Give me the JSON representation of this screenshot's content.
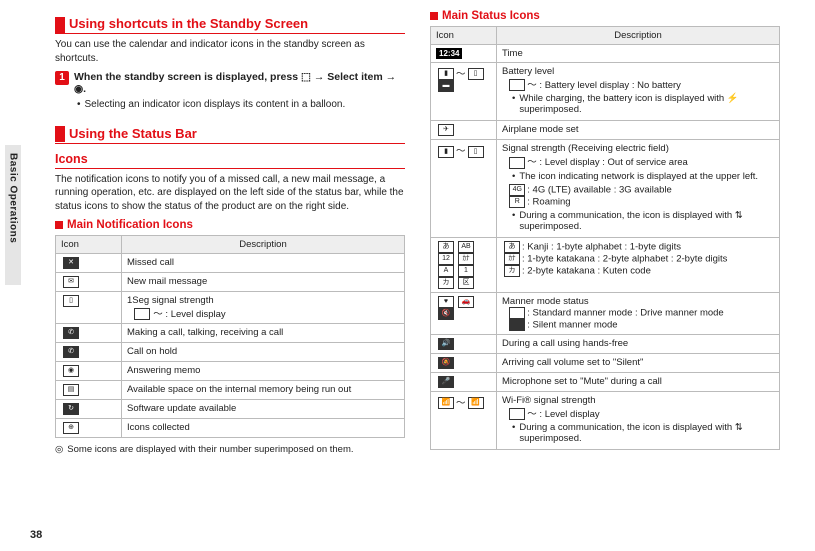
{
  "page_number": "38",
  "side_tab": "Basic Operations",
  "left": {
    "h_shortcuts": "Using shortcuts in the Standby Screen",
    "p_shortcuts": "You can use the calendar and indicator icons in the standby screen as shortcuts.",
    "step1_num": "1",
    "step1_text": "When the standby screen is displayed, press ⬚ → Select item → ◉.",
    "step1_sub": "Selecting an indicator icon displays its content in a balloon.",
    "h_statusbar": "Using the Status Bar",
    "h_icons": "Icons",
    "p_icons": "The notification icons to notify you of a missed call, a new mail message, a running operation, etc. are displayed on the left side of the status bar, while the status icons to show the status of the product are on the right side.",
    "h_notif": "Main Notification Icons",
    "th_icon": "Icon",
    "th_desc": "Description",
    "r1": "Missed call",
    "r2": "New mail message",
    "r3": "1Seg signal strength",
    "r3_sub": "～ : Level display",
    "r4": "Making a call, talking, receiving a call",
    "r5": "Call on hold",
    "r6": "Answering memo",
    "r7": "Available space on the internal memory being run out",
    "r8": "Software update available",
    "r9": "Icons collected",
    "note": "Some icons are displayed with their number superimposed on them."
  },
  "right": {
    "h_status": "Main Status Icons",
    "th_icon": "Icon",
    "th_desc": "Description",
    "r1": "Time",
    "r2": "Battery level",
    "r2_a": "～ : Battery level display   : No battery",
    "r2_b": "While charging, the battery icon is displayed with ⚡ superimposed.",
    "r3": "Airplane mode set",
    "r4": "Signal strength (Receiving electric field)",
    "r4_a": "～ : Level display   : Out of service area",
    "r4_b": "The icon indicating network is displayed at the upper left.",
    "r4_c": ": 4G (LTE) available     : 3G available",
    "r4_d": ": Roaming",
    "r4_e": "During a communication, the icon is displayed with ⇅ superimposed.",
    "r5a": ": Kanji  : 1-byte alphabet  : 1-byte digits",
    "r5b": ": 1-byte katakana  : 2-byte alphabet  : 2-byte digits",
    "r5c": ": 2-byte katakana  : Kuten code",
    "i_kanji": "あ",
    "i_ab1": "AB",
    "i_d1": "12",
    "i_kata1": "ｶﾅ",
    "i_ab2": "A",
    "i_d2": "1",
    "i_kata2": "カ",
    "i_kuten": "区",
    "r6": "Manner mode status",
    "r6_a": ": Standard manner mode   : Drive manner mode",
    "r6_b": ": Silent manner mode",
    "r7": "During a call using hands-free",
    "r8": "Arriving call volume set to \"Silent\"",
    "r9": "Microphone set to \"Mute\" during a call",
    "r10": "Wi-Fi® signal strength",
    "r10_a": "～ : Level display",
    "r10_b": "During a communication, the icon is displayed with ⇅ superimposed."
  }
}
